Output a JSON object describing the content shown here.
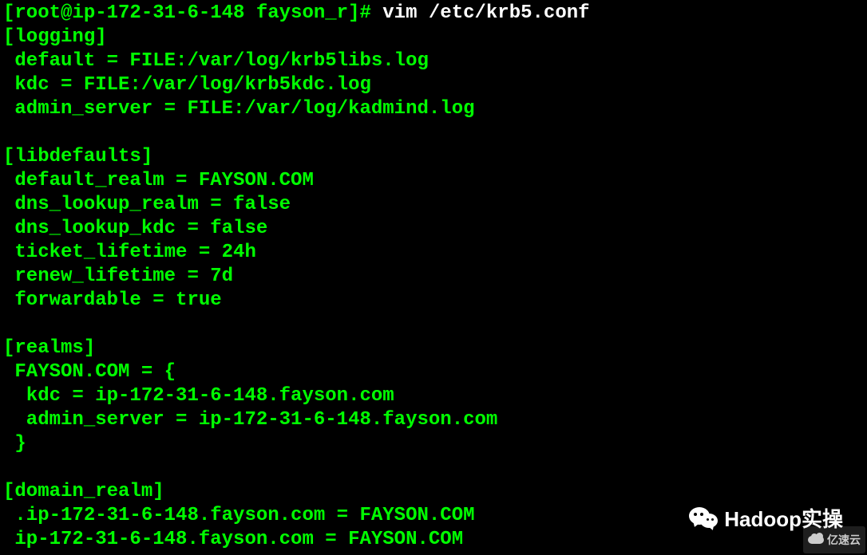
{
  "prompt": {
    "user_host": "[root@ip-172-31-6-148 fayson_r]# ",
    "command": "vim /etc/krb5.conf"
  },
  "config": {
    "logging_header": "[logging]",
    "logging_default": " default = FILE:/var/log/krb5libs.log",
    "logging_kdc": " kdc = FILE:/var/log/krb5kdc.log",
    "logging_admin": " admin_server = FILE:/var/log/kadmind.log",
    "blank1": "",
    "libdefaults_header": "[libdefaults]",
    "libdefaults_realm": " default_realm = FAYSON.COM",
    "libdefaults_dns_realm": " dns_lookup_realm = false",
    "libdefaults_dns_kdc": " dns_lookup_kdc = false",
    "libdefaults_ticket": " ticket_lifetime = 24h",
    "libdefaults_renew": " renew_lifetime = 7d",
    "libdefaults_forward": " forwardable = true",
    "blank2": "",
    "realms_header": "[realms]",
    "realms_open": " FAYSON.COM = {",
    "realms_kdc": "  kdc = ip-172-31-6-148.fayson.com",
    "realms_admin": "  admin_server = ip-172-31-6-148.fayson.com",
    "realms_close": " }",
    "blank3": "",
    "domain_header": "[domain_realm]",
    "domain_dot": " .ip-172-31-6-148.fayson.com = FAYSON.COM",
    "domain_nodot": " ip-172-31-6-148.fayson.com = FAYSON.COM"
  },
  "watermarks": {
    "wechat_text": "Hadoop实操",
    "yisu_text": "亿速云"
  }
}
